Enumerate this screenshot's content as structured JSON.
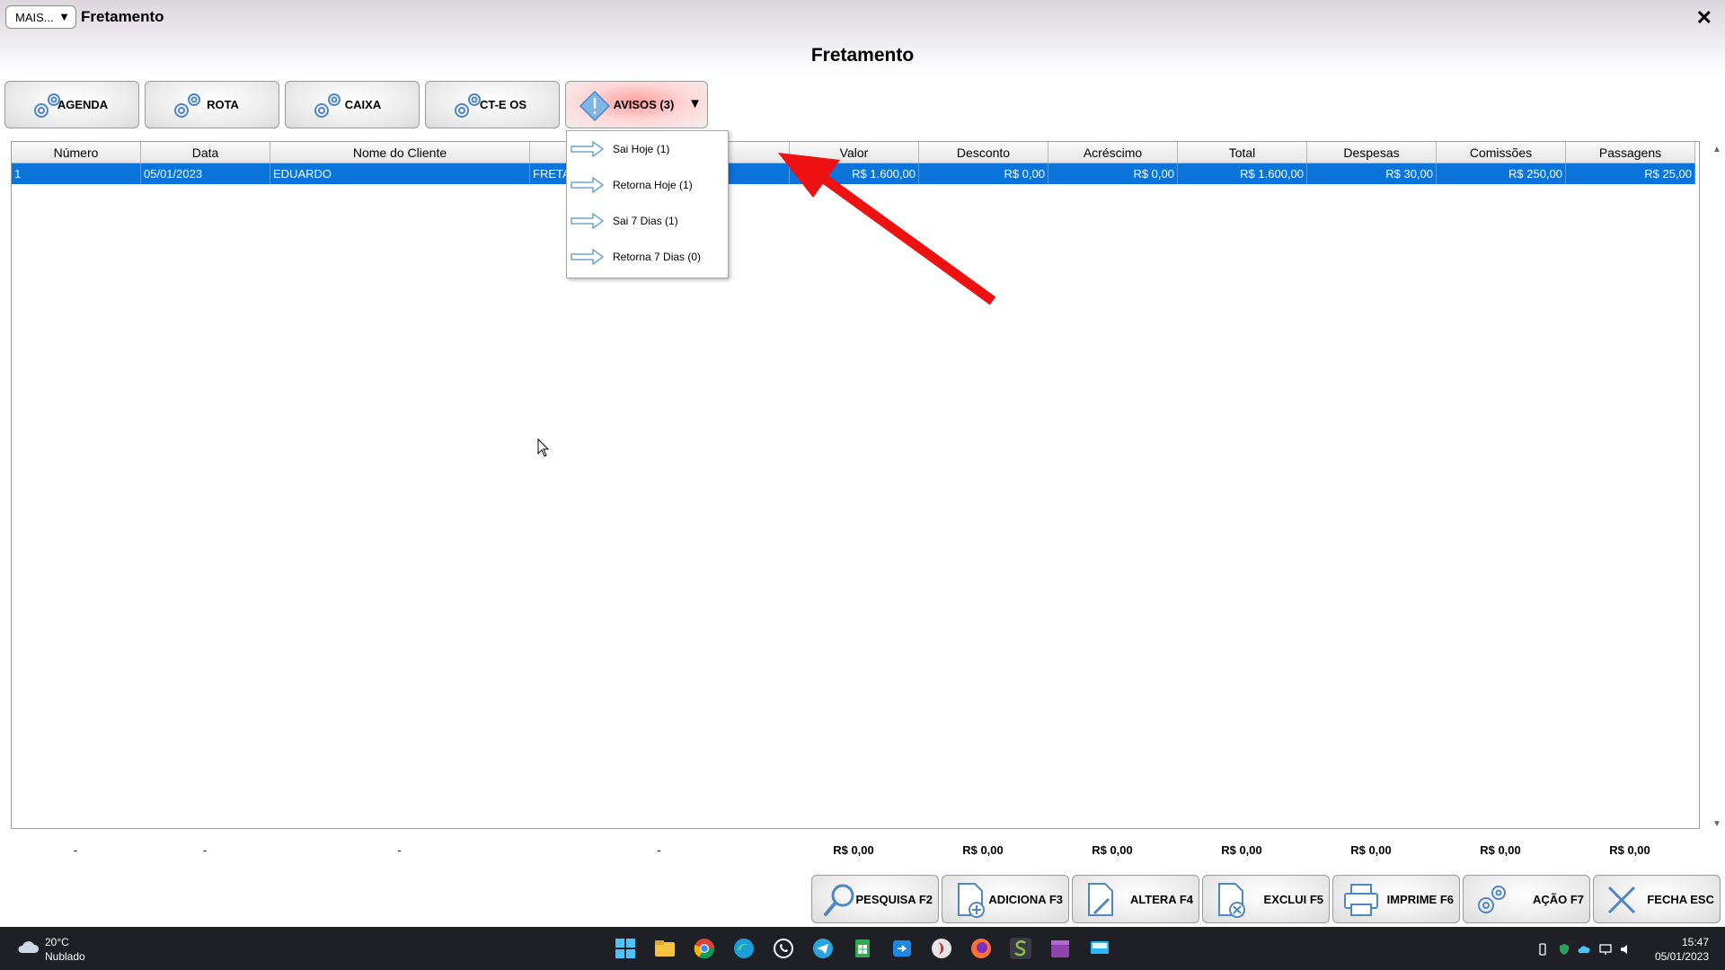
{
  "window": {
    "menu_button": "MAIS...",
    "title": "Fretamento",
    "close_glyph": "✕"
  },
  "page_title": "Fretamento",
  "toolbar": {
    "agenda": "AGENDA",
    "rota": "ROTA",
    "caixa": "CAIXA",
    "cte_os": "CT-E OS",
    "avisos": "AVISOS (3)",
    "avisos_dropdown_glyph": "▼"
  },
  "avisos_menu": {
    "items": [
      "Sai Hoje (1)",
      "Retorna Hoje (1)",
      "Sai 7 Dias (1)",
      "Retorna 7 Dias (0)"
    ]
  },
  "grid": {
    "columns": [
      "Número",
      "Data",
      "Nome do Cliente",
      "",
      "Valor",
      "Desconto",
      "Acréscimo",
      "Total",
      "Despesas",
      "Comissões",
      "Passagens"
    ],
    "rows": [
      {
        "numero": "1",
        "data": "05/01/2023",
        "cliente": "EDUARDO",
        "col4": "FRETA",
        "valor": "R$ 1.600,00",
        "desconto": "R$ 0,00",
        "acrescimo": "R$ 0,00",
        "total": "R$ 1.600,00",
        "despesas": "R$ 30,00",
        "comissoes": "R$ 250,00",
        "passagens": "R$ 25,00"
      }
    ],
    "row_highlight_color": "#0a74da"
  },
  "totals": {
    "numero": "-",
    "data": "-",
    "cliente": "-",
    "col4": "-",
    "valor": "R$ 0,00",
    "desconto": "R$ 0,00",
    "acrescimo": "R$ 0,00",
    "total": "R$ 0,00",
    "despesas": "R$ 0,00",
    "comissoes": "R$ 0,00",
    "passagens": "R$ 0,00"
  },
  "bottom_toolbar": {
    "pesquisa": "PESQUISA F2",
    "adiciona": "ADICIONA F3",
    "altera": "ALTERA F4",
    "exclui": "EXCLUI F5",
    "imprime": "IMPRIME F6",
    "acao": "AÇÃO F7",
    "fecha": "FECHA ESC"
  },
  "taskbar": {
    "weather_temp": "20°C",
    "weather_desc": "Nublado",
    "time": "15:47",
    "date": "05/01/2023",
    "apps": [
      "start-icon",
      "file-explorer-icon",
      "chrome-icon",
      "edge-icon",
      "whatsapp-icon",
      "telegram-icon",
      "sheets-icon",
      "remote-icon",
      "app-red-icon",
      "firefox-icon",
      "app-s-icon",
      "clapper-icon",
      "screen-icon"
    ]
  },
  "annotation_color": "#ee1111"
}
